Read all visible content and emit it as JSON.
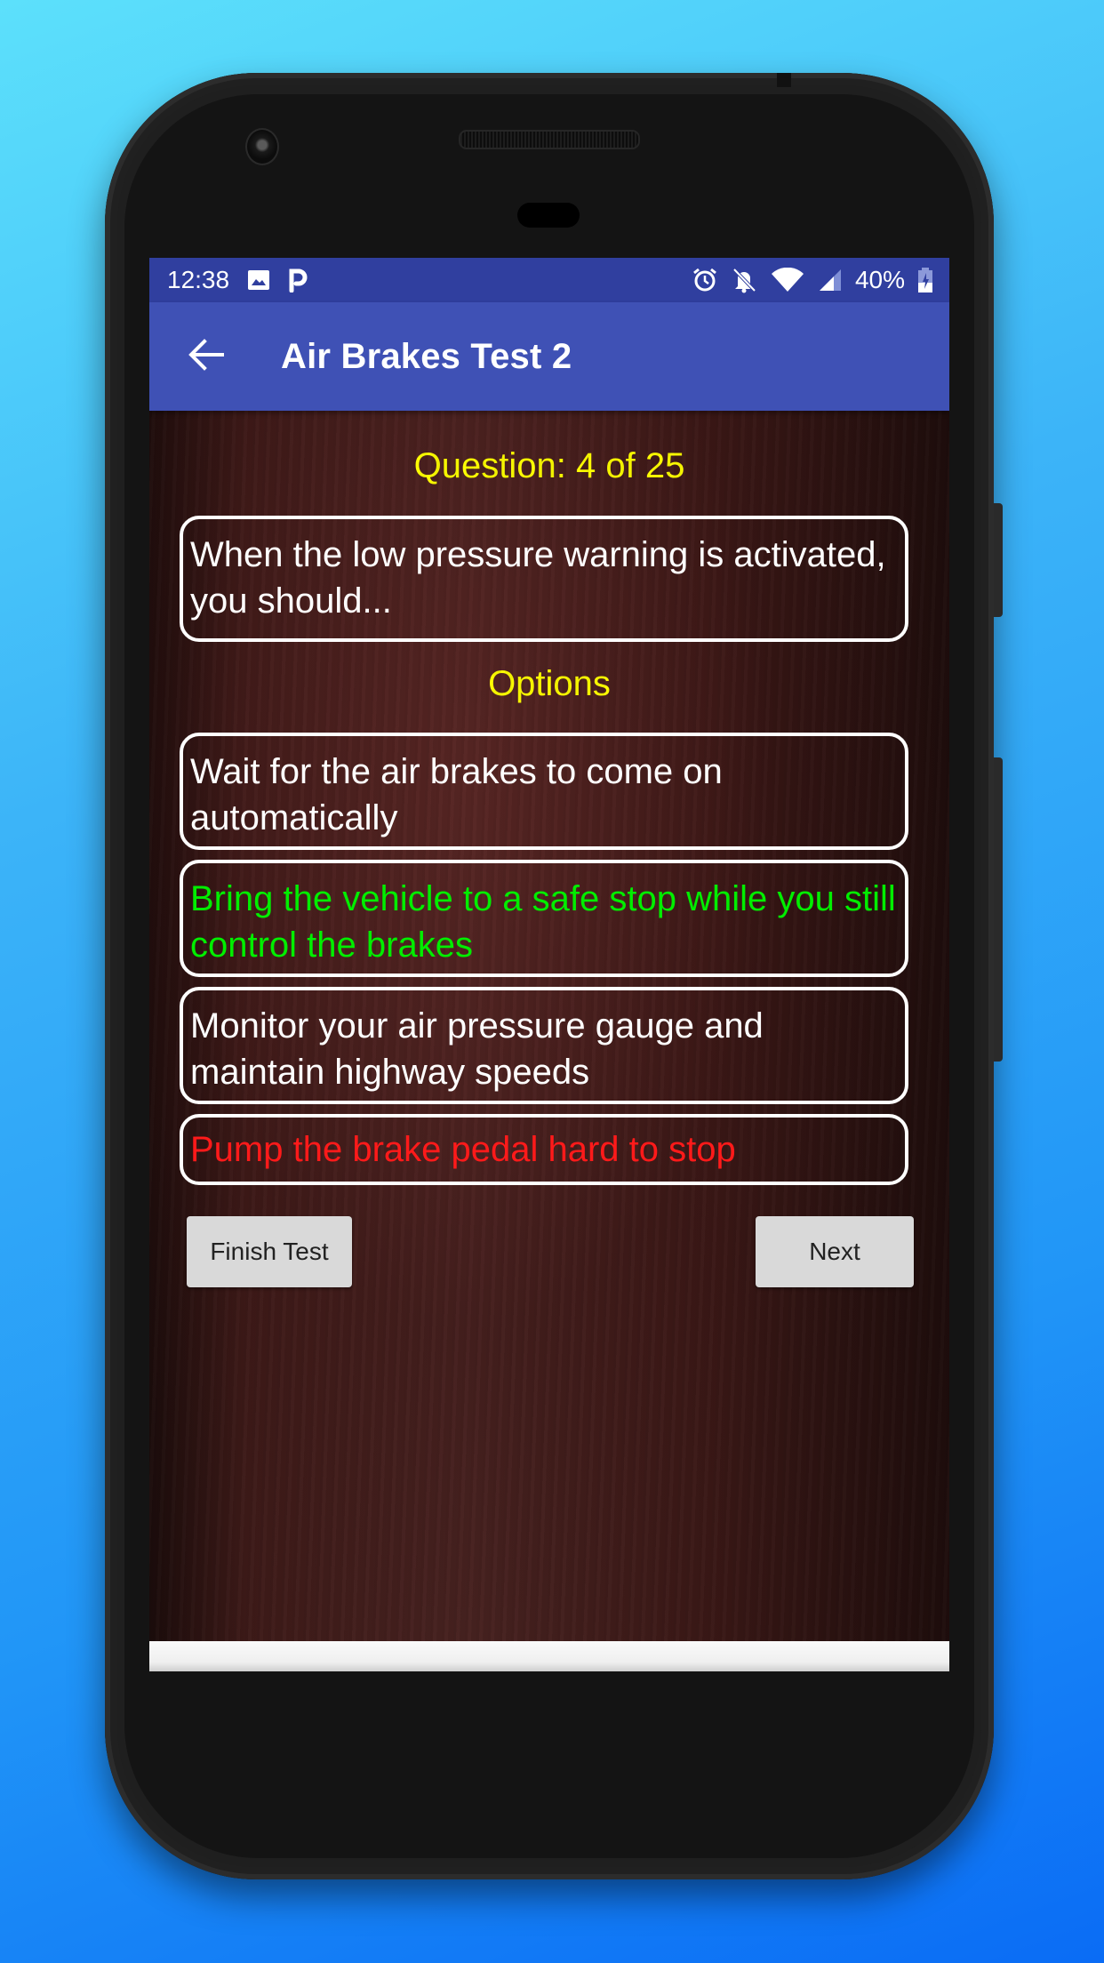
{
  "status_bar": {
    "time": "12:38",
    "left_icons": [
      "image-icon",
      "parking-icon"
    ],
    "right_icons": [
      "alarm-icon",
      "bell-off-icon",
      "wifi-icon",
      "signal-icon"
    ],
    "battery_percent": "40%",
    "battery_level": 0.4
  },
  "app_bar": {
    "back_icon": "arrow-left-icon",
    "title": "Air Brakes Test 2"
  },
  "quiz": {
    "counter": "Question: 4 of 25",
    "question": "When the low pressure warning is activated, you should...",
    "options_label": "Options",
    "options": [
      {
        "text": "Wait for the air brakes to come on automatically",
        "state": "neutral",
        "color": "#ffffff"
      },
      {
        "text": "Bring the vehicle to a safe stop while you still control the brakes",
        "state": "correct",
        "color": "#00ee00"
      },
      {
        "text": "Monitor your air pressure gauge and maintain highway speeds",
        "state": "neutral",
        "color": "#ffffff"
      },
      {
        "text": "Pump the brake pedal hard to stop",
        "state": "wrong",
        "color": "#ff1a1a"
      }
    ]
  },
  "buttons": {
    "finish": "Finish Test",
    "next": "Next"
  },
  "colors": {
    "status_bar": "#303f9f",
    "app_bar": "#3f51b5",
    "heading_yellow": "#ffff00",
    "correct_green": "#00ee00",
    "wrong_red": "#ff1a1a"
  }
}
